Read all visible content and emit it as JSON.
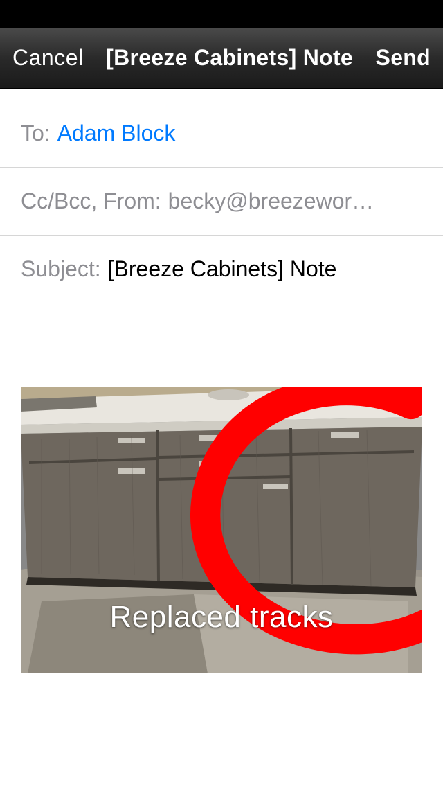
{
  "nav": {
    "cancel": "Cancel",
    "title": "[Breeze Cabinets] Note",
    "send": "Send"
  },
  "compose": {
    "to_label": "To:",
    "to_value": "Adam Block",
    "cc_label": "Cc/Bcc, From:",
    "cc_value": "becky@breezewor…",
    "subject_label": "Subject:",
    "subject_value": "[Breeze Cabinets] Note"
  },
  "attachment": {
    "caption": "Replaced tracks"
  }
}
